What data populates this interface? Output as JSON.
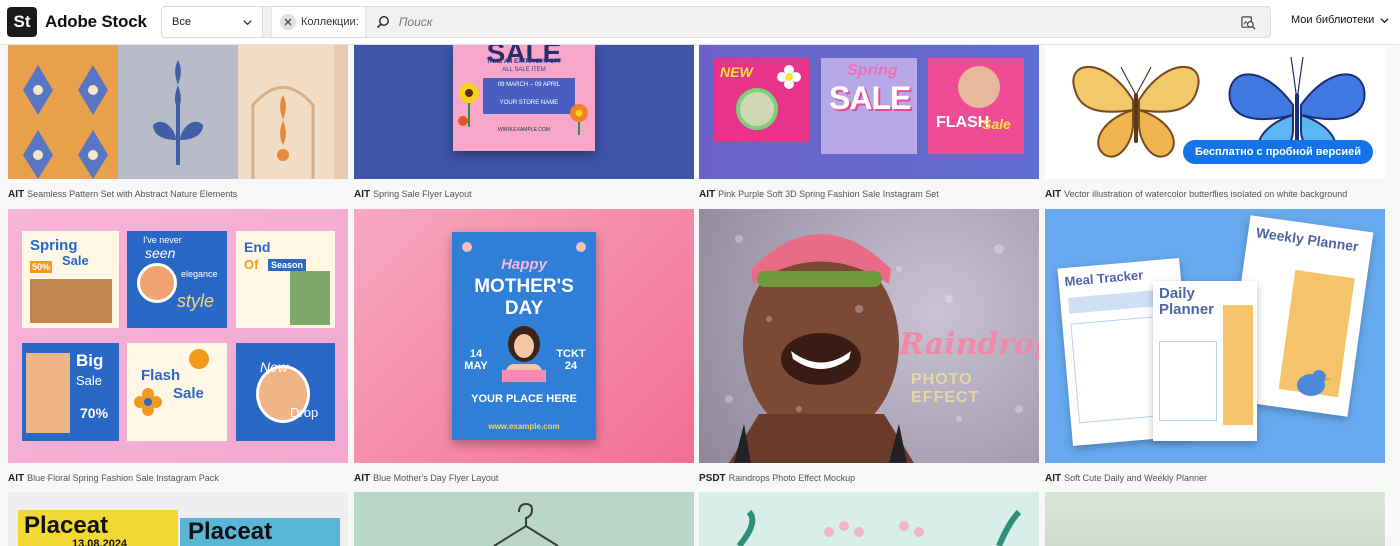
{
  "header": {
    "logo_mark": "St",
    "logo_text": "Adobe Stock",
    "asset_filter": "Все",
    "collection_chip": "Коллекции:",
    "search_placeholder": "Поиск",
    "libraries_label": "Мои библиотеки"
  },
  "trial_button": "Бесплатно с пробной версией",
  "rows": [
    [
      {
        "format": "AIT",
        "title": "Seamless Pattern Set with Abstract Nature Elements"
      },
      {
        "format": "AIT",
        "title": "Spring Sale Flyer Layout"
      },
      {
        "format": "AIT",
        "title": "Pink Purple Soft 3D Spring Fashion Sale Instagram Set"
      },
      {
        "format": "AIT",
        "title": "Vector illustration of watercolor butterflies isolated on white background"
      }
    ],
    [
      {
        "format": "AIT",
        "title": "Blue Floral Spring Fashion Sale Instagram Pack"
      },
      {
        "format": "AIT",
        "title": "Blue Mother's Day Flyer Layout"
      },
      {
        "format": "PSDT",
        "title": "Raindrops Photo Effect Mockup"
      },
      {
        "format": "AIT",
        "title": "Soft Cute Daily and Weekly Planner"
      }
    ]
  ],
  "thumb_text": {
    "sale_flyer": {
      "word": "SALE",
      "line1": "TAKE AN EXTRA 30% OFF",
      "line2": "ALL SALE ITEM",
      "dates": "09 MARCH – 09 APRIL",
      "store": "YOUR STORE NAME",
      "site": "WWW.EXAMPLE.COM"
    },
    "ig_set": {
      "new": "NEW",
      "spring": "Spring",
      "sale": "SALE",
      "flash": "FLASH",
      "flash_sale": "Sale"
    },
    "floral_pack": {
      "spring": "Spring",
      "sale": "Sale",
      "pct": "50%",
      "never": "I've never",
      "seen": "seen",
      "elegance": "elegance",
      "style": "style",
      "end": "End",
      "of": "Of",
      "season": "Season",
      "big": "Big",
      "big_sale": "Sale",
      "pct70": "70%",
      "flash": "Flash",
      "flash_sale": "Sale",
      "new_drop": "New",
      "drop": "Drop"
    },
    "mothers_day": {
      "happy": "Happy",
      "mothers": "MOTHER'S",
      "day": "DAY",
      "date": "14",
      "month": "MAY",
      "ticket": "TCKT",
      "num": "24",
      "place": "YOUR PLACE HERE",
      "site": "www.example.com"
    },
    "raindrops": {
      "title": "Raindrops",
      "sub": "PHOTO EFFECT"
    },
    "planner": {
      "meal": "Meal Tracker",
      "daily": "Daily",
      "planner": "Planner",
      "weekly": "Weekly Planner"
    },
    "placeat": {
      "word": "Placeat",
      "date": "13.08.2024"
    }
  },
  "colors": {
    "accent": "#1473e6"
  }
}
